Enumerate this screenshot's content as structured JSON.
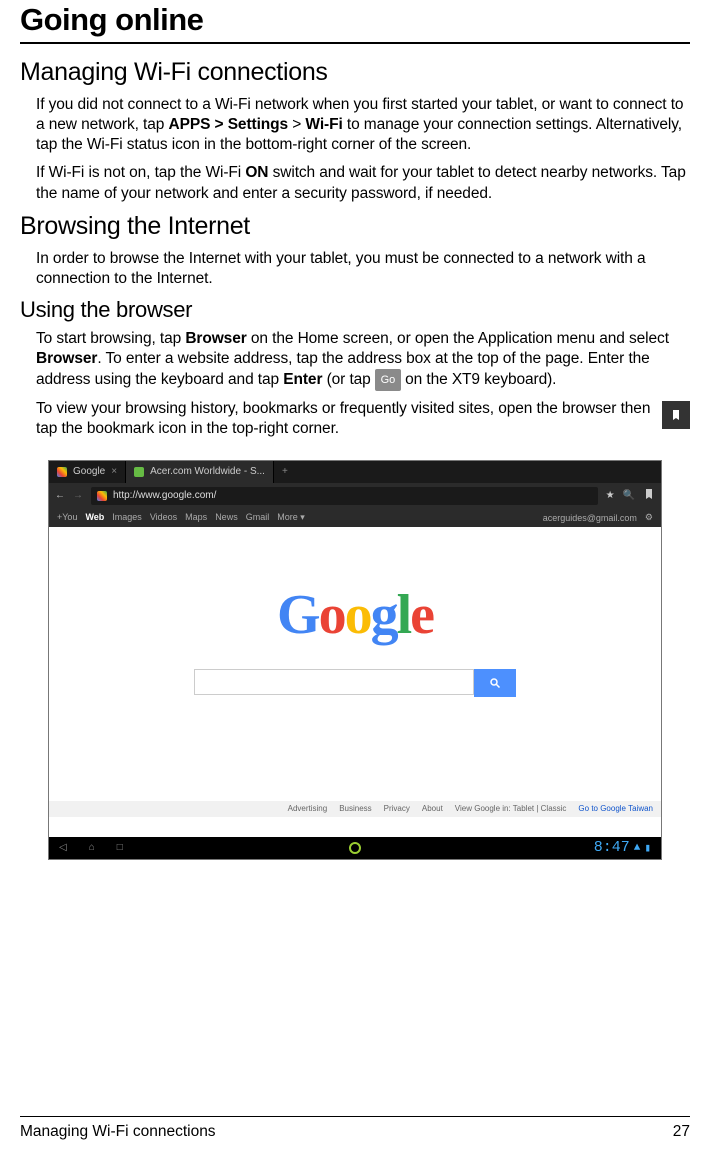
{
  "title": "Going online",
  "sections": {
    "wifi": {
      "heading": "Managing Wi-Fi connections",
      "p1_pre": "If you did not connect to a Wi-Fi network when you first started your tablet, or want to connect to a new network, tap ",
      "p1_b1": "APPS > Settings",
      "p1_mid": " > ",
      "p1_b2": "Wi-Fi",
      "p1_post": " to manage your connection settings. Alternatively, tap the Wi-Fi status icon in the bottom-right corner of the screen.",
      "p2_pre": "If Wi-Fi is not on, tap the Wi-Fi ",
      "p2_b": "ON",
      "p2_post": " switch and wait for your tablet to detect nearby networks. Tap the name of your network and enter a security password, if needed."
    },
    "browse": {
      "heading": "Browsing the Internet",
      "p1": "In order to browse the Internet with your tablet, you must be connected to a network with a connection to the Internet."
    },
    "using": {
      "heading": "Using the browser",
      "p1_pre": "To start browsing, tap ",
      "p1_b1": "Browser",
      "p1_mid1": " on the Home screen, or open the Application menu and select ",
      "p1_b2": "Browser",
      "p1_mid2": ". To enter a website address, tap the address box at the top of the page. Enter the address using the keyboard and tap ",
      "p1_b3": "Enter",
      "p1_mid3": " (or tap ",
      "go_label": "Go",
      "p1_post": " on the XT9 keyboard).",
      "p2": "To view your browsing history, bookmarks or frequently visited sites, open the browser then tap the bookmark icon in the top-right corner."
    }
  },
  "browser_shot": {
    "tab1": "Google",
    "tab2": "Acer.com Worldwide - S...",
    "url": "http://www.google.com/",
    "gbar": [
      "+You",
      "Web",
      "Images",
      "Videos",
      "Maps",
      "News",
      "Gmail",
      "More ▾"
    ],
    "account": "acerguides@gmail.com",
    "logo": "Google",
    "footer_links": [
      "Advertising",
      "Business",
      "Privacy",
      "About"
    ],
    "footer_view": "View Google in: Tablet | Classic",
    "footer_go": "Go to Google Taiwan",
    "clock": "8:47"
  },
  "footer": {
    "left": "Managing Wi-Fi connections",
    "right": "27"
  }
}
